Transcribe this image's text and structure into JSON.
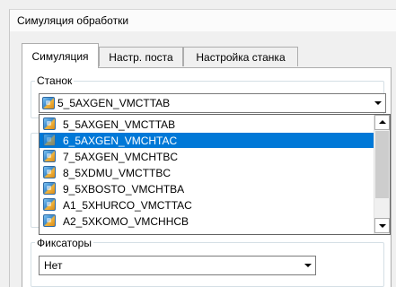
{
  "window": {
    "title": "Симуляция обработки"
  },
  "tabs": [
    {
      "label": "Симуляция",
      "active": true
    },
    {
      "label": "Настр. поста",
      "active": false
    },
    {
      "label": "Настройка станка",
      "active": false
    }
  ],
  "machine_group": {
    "label": "Станок",
    "selected_value": "5_5AXGEN_VMCTTAB",
    "icon": "machine-icon"
  },
  "machine_list": {
    "items": [
      "5_5AXGEN_VMCTTAB",
      "6_5AXGEN_VMCHTAC",
      "7_5AXGEN_VMCHTBC",
      "8_5XDMU_VMCTTBC",
      "9_5XBOSTO_VMCHTBA",
      "A1_5XHURCO_VMCTTAC",
      "A2_5XKOMO_VMCHHCB"
    ],
    "highlighted_index": 1,
    "highlight_color": "#0078d7"
  },
  "fixtures_group": {
    "label": "Фиксаторы",
    "selected_value": "Нет"
  }
}
